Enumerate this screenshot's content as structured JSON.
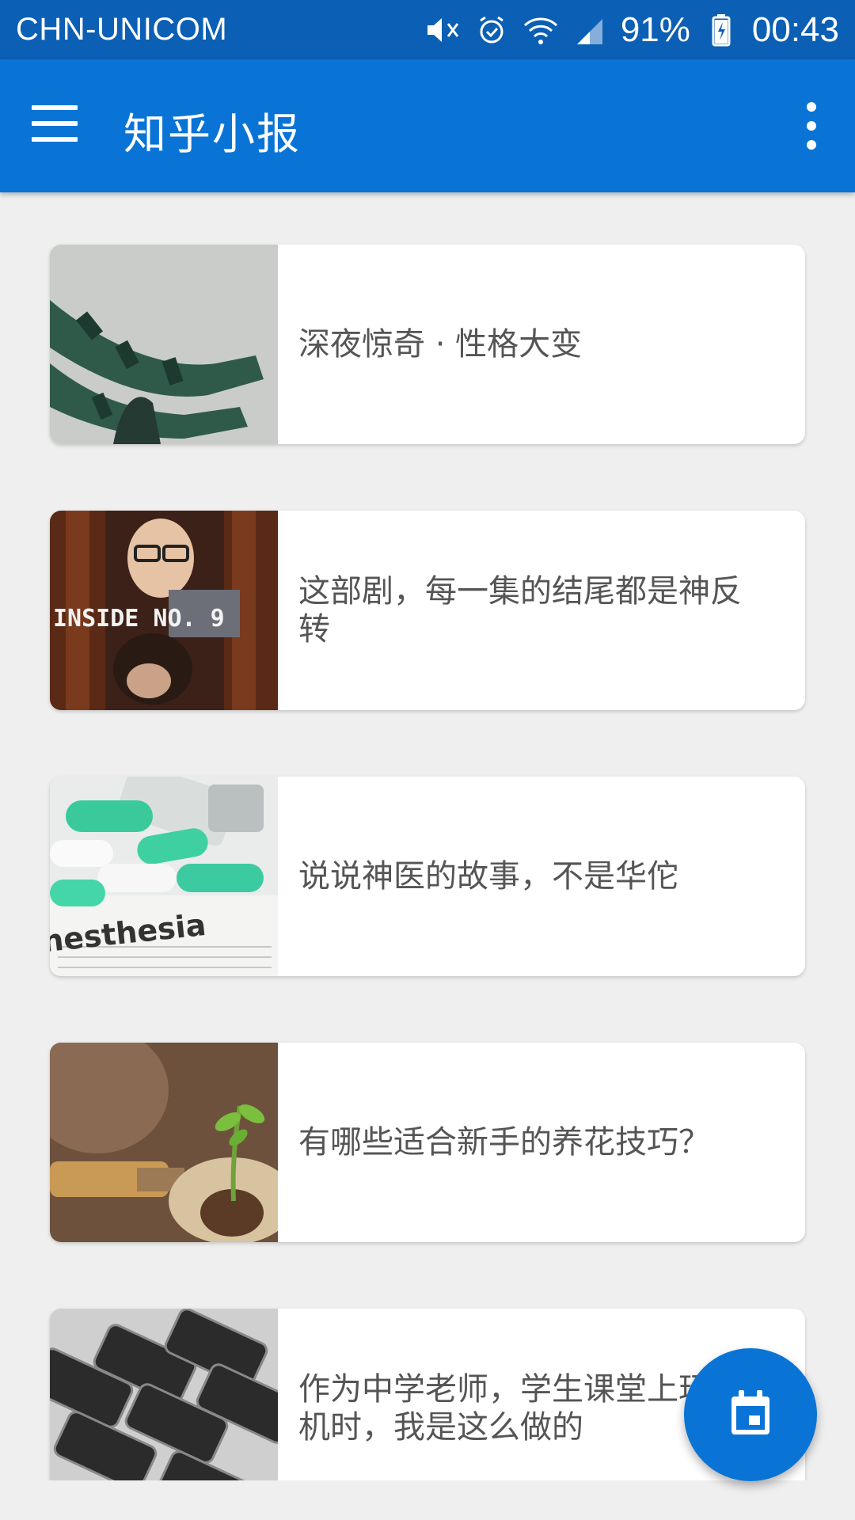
{
  "status_bar": {
    "carrier": "CHN-UNICOM",
    "battery_percent": "91%",
    "time": "00:43",
    "icons": [
      "mute-icon",
      "alarm-icon",
      "wifi-icon",
      "signal-icon",
      "battery-charging-icon"
    ]
  },
  "app_bar": {
    "title": "知乎小报",
    "menu_icon": "hamburger-menu-icon",
    "overflow_icon": "more-vert-icon"
  },
  "stories": [
    {
      "title": "深夜惊奇 · 性格大变",
      "thumb": "green-striped-arms-image"
    },
    {
      "title": "这部剧，每一集的结尾都是神反转",
      "thumb": "inside-no-9-poster",
      "thumb_text": "INSIDE NO. 9"
    },
    {
      "title": "说说神医的故事，不是华佗",
      "thumb": "anesthesia-pills-image",
      "thumb_text": "nesthesia"
    },
    {
      "title": "有哪些适合新手的养花技巧？",
      "thumb": "seedling-in-soil-image"
    },
    {
      "title": "作为中学老师，学生课堂上玩手机时，我是这么做的",
      "thumb": "smartphones-stack-image"
    }
  ],
  "fab": {
    "icon": "calendar-icon"
  },
  "colors": {
    "primary": "#0a74d6",
    "status": "#0b5fb4",
    "background": "#efefef"
  }
}
